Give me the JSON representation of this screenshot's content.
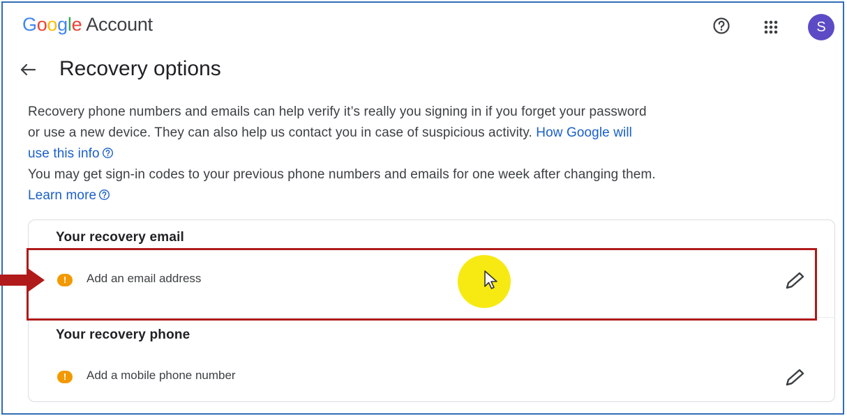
{
  "header": {
    "logo_google": [
      "G",
      "o",
      "o",
      "g",
      "l",
      "e"
    ],
    "logo_account": "Account",
    "help_icon": "help-circle-icon",
    "apps_icon": "apps-grid-icon",
    "avatar_initial": "S",
    "avatar_color": "#5b4bc4"
  },
  "page": {
    "back_icon": "arrow-left-icon",
    "title": "Recovery options",
    "intro": "Recovery phone numbers and emails can help verify it’s really you signing in if you forget your password or use a new device. They can also help us contact you in case of suspicious activity.",
    "intro_link": "How Google will use this info",
    "codes_note": "You may get sign-in codes to your previous phone numbers and emails for one week after changing them.",
    "codes_link": "Learn more"
  },
  "recovery": {
    "email": {
      "title": "Your recovery email",
      "status_icon": "warning-icon",
      "label": "Add an email address",
      "edit_icon": "pencil-icon"
    },
    "phone": {
      "title": "Your recovery phone",
      "status_icon": "warning-icon",
      "label": "Add a mobile phone number",
      "edit_icon": "pencil-icon"
    }
  },
  "colors": {
    "accent_link": "#1a5fc9",
    "warning": "#f29900",
    "annotation_red": "#b01a1a",
    "cursor_highlight": "#f7ea12"
  }
}
